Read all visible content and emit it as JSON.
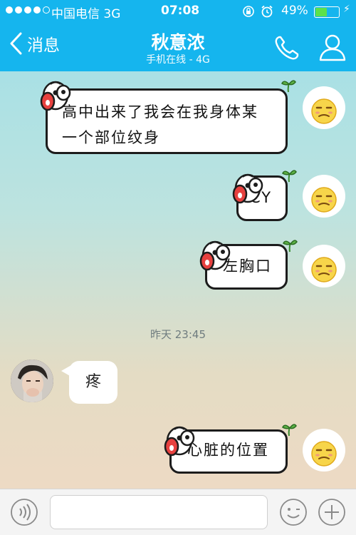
{
  "status": {
    "carrier": "中国电信  3G",
    "time": "07:08",
    "battery": "49%",
    "battery_level": 0.49
  },
  "nav": {
    "back_label": "消息",
    "title": "秋意浓",
    "subtitle": "手机在线 - 4G"
  },
  "messages": [
    {
      "text_line1": "高中出来了我会在我身体某",
      "text_line2": "一个部位纹身"
    },
    {
      "text": "CY"
    },
    {
      "text": "左胸口"
    },
    {
      "text": "疼"
    },
    {
      "text": "心脏的位置"
    }
  ],
  "timestamp": "昨天 23:45",
  "colors": {
    "header": "#15b5ee",
    "battery": "#5ce14b",
    "bubble_border": "#1c1c1c"
  },
  "icons": {
    "back": "chevron-left-icon",
    "call": "phone-icon",
    "profile": "person-icon",
    "voice": "voice-icon",
    "emoji": "smiley-icon",
    "more": "plus-icon"
  }
}
